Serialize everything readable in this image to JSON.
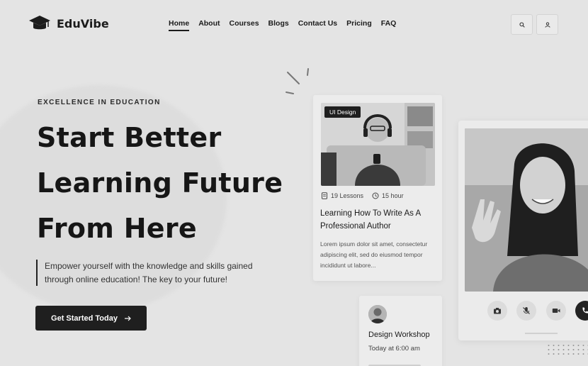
{
  "brand": {
    "name": "EduVibe"
  },
  "nav": [
    {
      "label": "Home",
      "active": true
    },
    {
      "label": "About"
    },
    {
      "label": "Courses"
    },
    {
      "label": "Blogs"
    },
    {
      "label": "Contact Us"
    },
    {
      "label": "Pricing"
    },
    {
      "label": "FAQ"
    }
  ],
  "header_actions": {
    "search_icon": "search-icon",
    "user_icon": "user-icon"
  },
  "hero": {
    "eyebrow": "EXCELLENCE IN EDUCATION",
    "headline_lines": [
      "Start Better",
      "Learning Future",
      "From Here"
    ],
    "description": "Empower yourself with the knowledge and skills gained through online education! The key to your future!",
    "cta_label": "Get Started Today"
  },
  "course_card": {
    "tag": "UI Design",
    "lessons": "19 Lessons",
    "duration": "15 hour",
    "title": "Learning How To Write As A Professional Author",
    "description": "Lorem ipsum dolor sit amet, consectetur adipiscing elit, sed do eiusmod tempor incididunt ut labore..."
  },
  "workshop_card": {
    "title": "Design Workshop",
    "time": "Today at 6:00 am"
  },
  "video_card": {
    "controls": [
      "camera-icon",
      "mic-off-icon",
      "video-icon",
      "phone-icon"
    ]
  },
  "colors": {
    "accent": "#1f1f1f",
    "background": "#e4e4e4",
    "card": "#ececec"
  }
}
